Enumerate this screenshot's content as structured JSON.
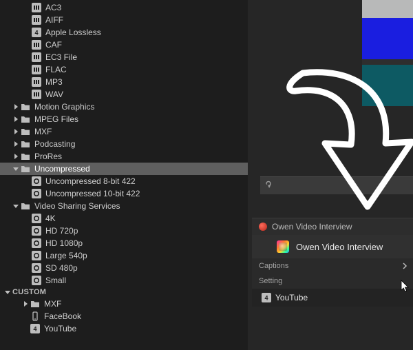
{
  "sidebar": {
    "audio_children": [
      {
        "label": "AC3",
        "icon": "codec"
      },
      {
        "label": "AIFF",
        "icon": "codec"
      },
      {
        "label": "Apple Lossless",
        "icon": "four"
      },
      {
        "label": "CAF",
        "icon": "codec"
      },
      {
        "label": "EC3 File",
        "icon": "codec"
      },
      {
        "label": "FLAC",
        "icon": "codec"
      },
      {
        "label": "MP3",
        "icon": "codec"
      },
      {
        "label": "WAV",
        "icon": "codec"
      }
    ],
    "folders_closed": [
      {
        "label": "Motion Graphics"
      },
      {
        "label": "MPEG Files"
      },
      {
        "label": "MXF"
      },
      {
        "label": "Podcasting"
      },
      {
        "label": "ProRes"
      }
    ],
    "uncompressed": {
      "label": "Uncompressed",
      "children": [
        {
          "label": "Uncompressed 8-bit 422"
        },
        {
          "label": "Uncompressed 10-bit 422"
        }
      ]
    },
    "video_sharing": {
      "label": "Video Sharing Services",
      "children": [
        {
          "label": "4K"
        },
        {
          "label": "HD 720p"
        },
        {
          "label": "HD 1080p"
        },
        {
          "label": "Large 540p"
        },
        {
          "label": "SD 480p"
        },
        {
          "label": "Small"
        }
      ]
    },
    "custom_header": "CUSTOM",
    "custom": [
      {
        "label": "MXF",
        "type": "folder"
      },
      {
        "label": "FaceBook",
        "type": "device"
      },
      {
        "label": "YouTube",
        "type": "four"
      }
    ]
  },
  "panel": {
    "header": "Owen Video Interview",
    "project": "Owen Video Interview",
    "captions_label": "Captions",
    "setting_label": "Setting",
    "setting_value": "YouTube"
  }
}
